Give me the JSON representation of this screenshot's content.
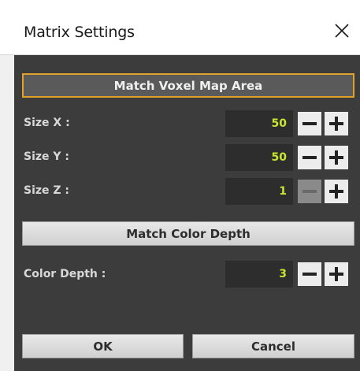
{
  "window": {
    "title": "Matrix Settings",
    "close_icon": "close-icon"
  },
  "buttons": {
    "match_voxel": "Match Voxel Map Area",
    "match_color": "Match Color Depth",
    "ok": "OK",
    "cancel": "Cancel"
  },
  "fields": {
    "size_x": {
      "label": "Size X :",
      "value": "50"
    },
    "size_y": {
      "label": "Size Y :",
      "value": "50"
    },
    "size_z": {
      "label": "Size Z :",
      "value": "1",
      "minus_disabled": true
    },
    "color_depth": {
      "label": "Color Depth :",
      "value": "3"
    }
  },
  "colors": {
    "panel": "#3c3c3c",
    "value_text": "#c8e630",
    "highlight_border": "#e0a22a"
  }
}
